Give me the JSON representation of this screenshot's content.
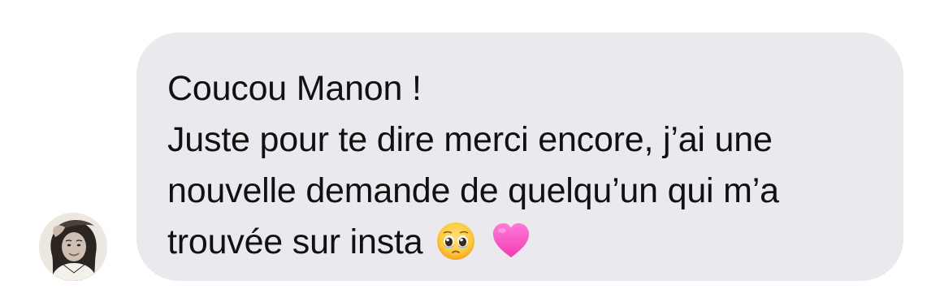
{
  "sender": {
    "avatar_icon": "profile-photo-avatar"
  },
  "message": {
    "lines": [
      "Coucou Manon !",
      "Juste pour te dire merci encore, j’ai une",
      "nouvelle demande de quelqu’un qui m’a",
      "trouvée sur insta"
    ],
    "emojis": [
      "pleading-face-emoji",
      "pink-heart-emoji"
    ],
    "bubble_color": "#e9e9ee",
    "text_color": "#111111"
  }
}
